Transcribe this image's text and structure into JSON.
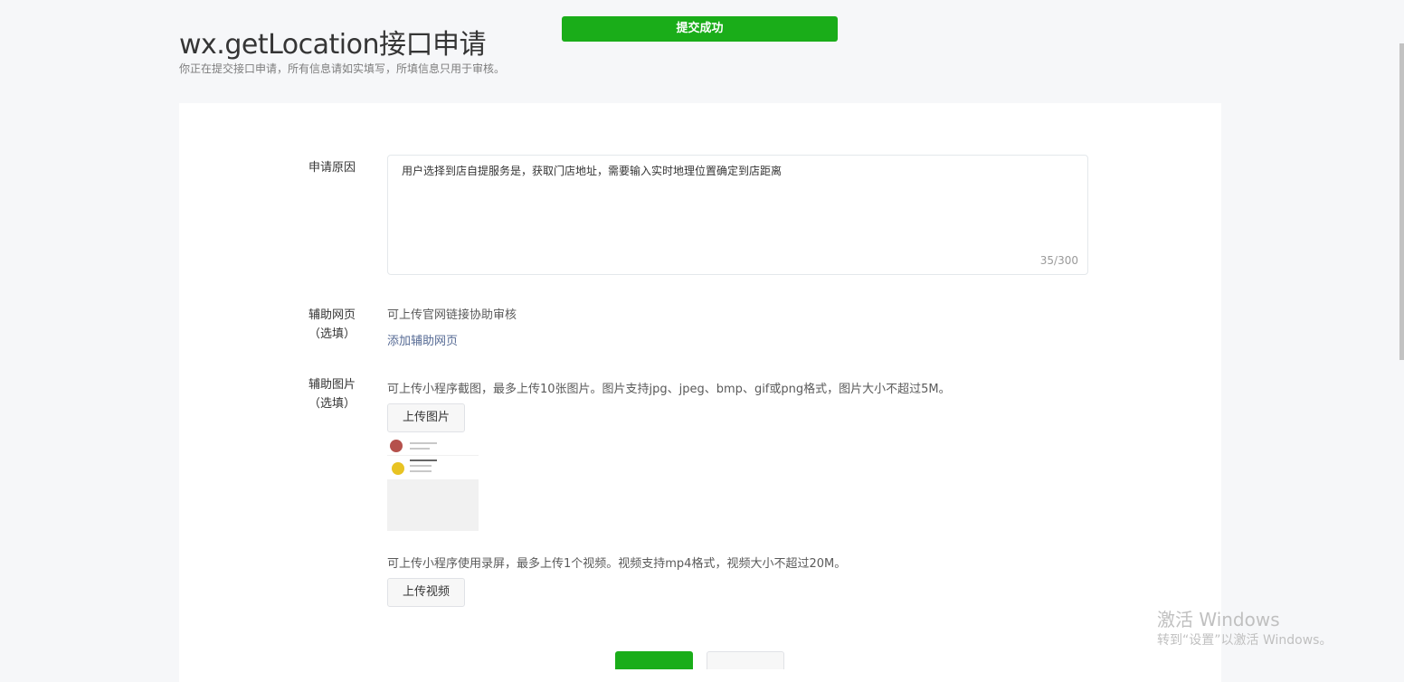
{
  "header": {
    "title": "wx.getLocation接口申请",
    "subtitle": "你正在提交接口申请，所有信息请如实填写，所填信息只用于审核。"
  },
  "toast": {
    "text": "提交成功"
  },
  "form": {
    "reason": {
      "label": "申请原因",
      "value": "用户选择到店自提服务是，获取门店地址，需要输入实时地理位置确定到店距离",
      "counter": "35/300"
    },
    "webpage": {
      "label_line1": "辅助网页",
      "label_line2": "（选填）",
      "hint": "可上传官网链接协助审核",
      "add_link": "添加辅助网页"
    },
    "images": {
      "label_line1": "辅助图片",
      "label_line2": "（选填）",
      "hint": "可上传小程序截图，最多上传10张图片。图片支持jpg、jpeg、bmp、gif或png格式，图片大小不超过5M。",
      "upload_label": "上传图片"
    },
    "video": {
      "hint": "可上传小程序使用录屏，最多上传1个视频。视频支持mp4格式，视频大小不超过20M。",
      "upload_label": "上传视频"
    }
  },
  "watermark": {
    "title": "激活 Windows",
    "subtitle": "转到“设置”以激活 Windows。"
  },
  "colors": {
    "accent": "#1aad19",
    "link": "#576b95"
  }
}
